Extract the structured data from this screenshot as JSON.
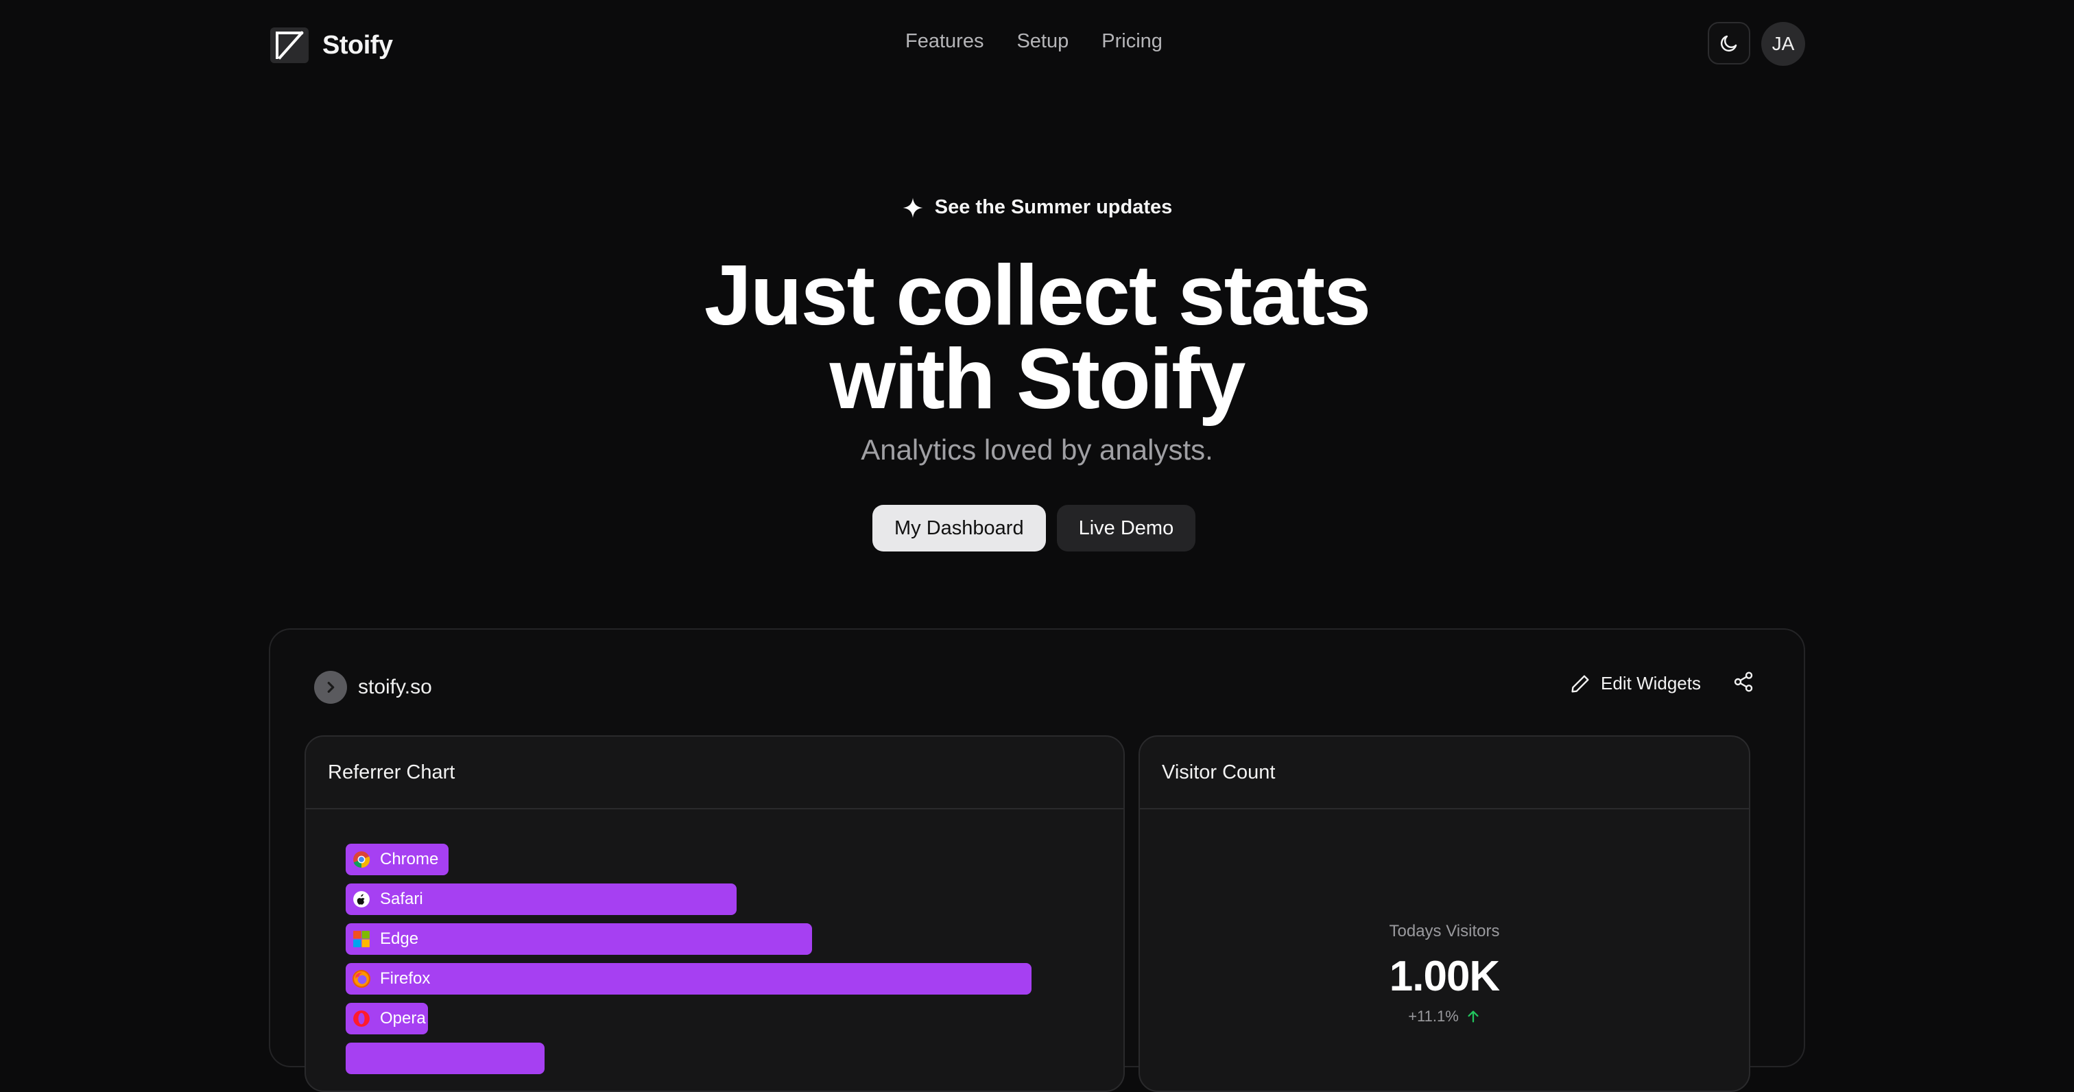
{
  "brand": {
    "name": "Stoify"
  },
  "nav": {
    "links": [
      "Features",
      "Setup",
      "Pricing"
    ],
    "avatar_initials": "JA"
  },
  "hero": {
    "update_text": "See the Summer updates",
    "title_line1": "Just collect stats",
    "title_line2": "with Stoify",
    "subtitle": "Analytics loved by analysts.",
    "primary_button": "My Dashboard",
    "secondary_button": "Live Demo"
  },
  "dashboard": {
    "site": "stoify.so",
    "edit_widgets": "Edit Widgets",
    "referrer_card_title": "Referrer Chart",
    "visitor_card_title": "Visitor Count",
    "visitors_label": "Todays Visitors",
    "visitors_value": "1.00K",
    "visitors_change": "+11.1%",
    "accent_color": "#a640f2",
    "up_color": "#22c55e"
  },
  "chart_data": {
    "type": "bar",
    "orientation": "horizontal",
    "categories": [
      "Chrome",
      "Safari",
      "Edge",
      "Firefox",
      "Opera",
      ""
    ],
    "values": [
      15,
      57,
      68,
      100,
      12,
      29
    ],
    "icons": [
      "chrome-icon",
      "safari-icon",
      "edge-icon",
      "firefox-icon",
      "opera-icon",
      ""
    ]
  }
}
